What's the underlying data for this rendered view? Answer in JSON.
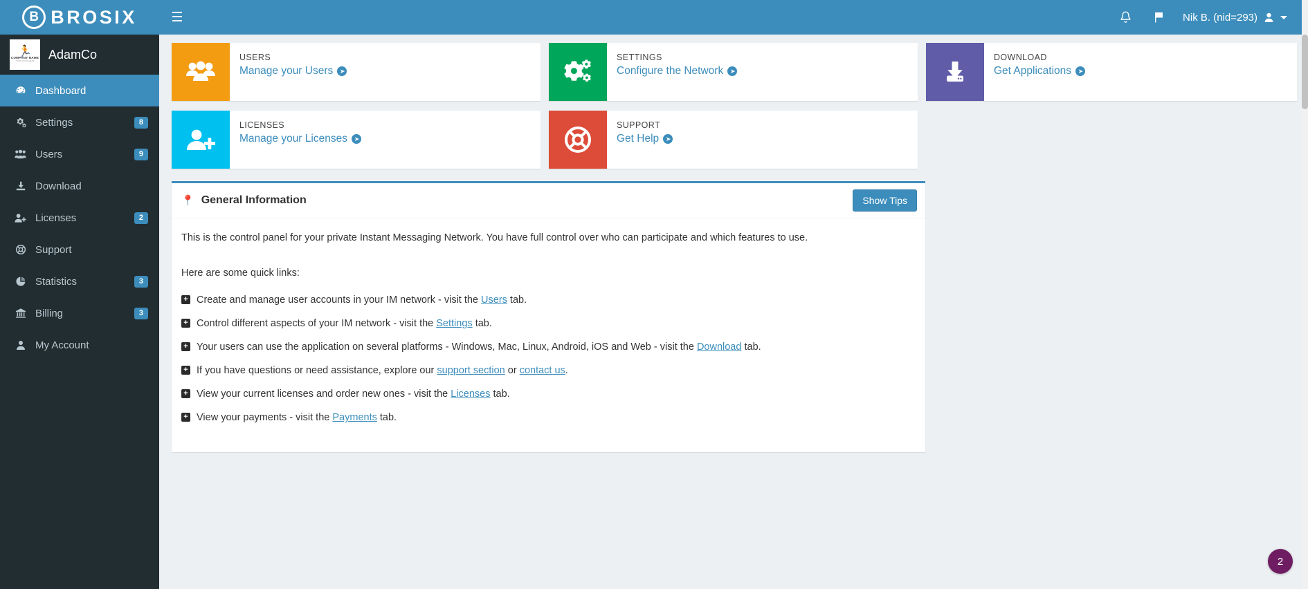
{
  "topbar": {
    "brand_letter": "B",
    "brand_text": "BROSIX",
    "hamburger_icon": "hamburger-menu-icon",
    "notifications_icon": "bell-icon",
    "flag_icon": "flag-icon",
    "user_label": "Nik B. (nid=293)",
    "user_icon": "user-avatar-icon",
    "accent_color": "#3c8dbc"
  },
  "sidebar": {
    "company_name": "AdamCo",
    "company_logo_caption": "COMPANY NAME",
    "company_logo_caption2": "YOUR TAGLINE HERE",
    "items": [
      {
        "label": "Dashboard",
        "icon": "dashboard-icon",
        "badge": "",
        "active": true
      },
      {
        "label": "Settings",
        "icon": "gears-icon",
        "badge": "8",
        "active": false
      },
      {
        "label": "Users",
        "icon": "users-icon",
        "badge": "9",
        "active": false
      },
      {
        "label": "Download",
        "icon": "download-icon",
        "badge": "",
        "active": false
      },
      {
        "label": "Licenses",
        "icon": "user-plus-icon",
        "badge": "2",
        "active": false
      },
      {
        "label": "Support",
        "icon": "lifebuoy-icon",
        "badge": "",
        "active": false
      },
      {
        "label": "Statistics",
        "icon": "pie-chart-icon",
        "badge": "3",
        "active": false
      },
      {
        "label": "Billing",
        "icon": "bank-icon",
        "badge": "3",
        "active": false
      },
      {
        "label": "My Account",
        "icon": "person-icon",
        "badge": "",
        "active": false
      }
    ]
  },
  "cards": {
    "users": {
      "title": "USERS",
      "link": "Manage your Users",
      "icon": "users-group-icon",
      "color": "#f39c12"
    },
    "licenses": {
      "title": "LICENSES",
      "link": "Manage your Licenses",
      "icon": "user-plus-icon",
      "color": "#00c0ef"
    },
    "settings": {
      "title": "SETTINGS",
      "link": "Configure the Network",
      "icon": "gears-icon",
      "color": "#00a65a"
    },
    "support": {
      "title": "SUPPORT",
      "link": "Get Help",
      "icon": "lifebuoy-icon",
      "color": "#dd4b39"
    },
    "download": {
      "title": "DOWNLOAD",
      "link": "Get Applications",
      "icon": "download-box-icon",
      "color": "#605ca8"
    }
  },
  "panel": {
    "title": "General Information",
    "title_icon": "pin-icon",
    "show_tips_label": "Show Tips",
    "intro": "This is the control panel for your private Instant Messaging Network. You have full control over who can participate and which features to use.",
    "quicklinks_lead": "Here are some quick links:",
    "quicklinks": [
      {
        "before": "Create and manage user accounts in your IM network - visit the ",
        "link": "Users",
        "after": " tab.",
        "link2": "",
        "mid": "",
        "after2": ""
      },
      {
        "before": "Control different aspects of your IM network - visit the ",
        "link": "Settings",
        "after": " tab.",
        "link2": "",
        "mid": "",
        "after2": ""
      },
      {
        "before": "Your users can use the application on several platforms - Windows, Mac, Linux, Android, iOS and Web - visit the ",
        "link": "Download",
        "after": " tab.",
        "link2": "",
        "mid": "",
        "after2": ""
      },
      {
        "before": "If you have questions or need assistance, explore our ",
        "link": "support section",
        "mid": " or ",
        "link2": "contact us",
        "after2": ".",
        "after": ""
      },
      {
        "before": "View your current licenses and order new ones - visit the ",
        "link": "Licenses",
        "after": " tab.",
        "link2": "",
        "mid": "",
        "after2": ""
      },
      {
        "before": "View your payments - visit the ",
        "link": "Payments",
        "after": " tab.",
        "link2": "",
        "mid": "",
        "after2": ""
      }
    ]
  },
  "float_badge": {
    "count": "2",
    "color": "#6f1d62"
  }
}
